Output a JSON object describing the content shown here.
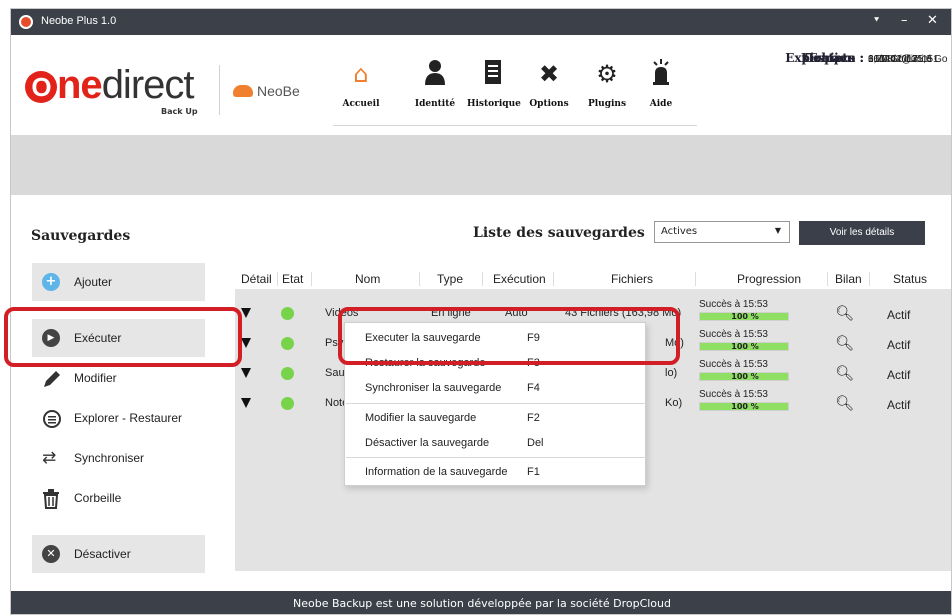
{
  "window": {
    "title": "Neobe Plus 1.0",
    "buttons": [
      "⯆",
      "–",
      "✕"
    ]
  },
  "header": {
    "logo": {
      "o": "O",
      "ne": "ne",
      "direct": "direct",
      "backup": "Back Up"
    },
    "neobe": "NeoBe",
    "tools": [
      {
        "label": "Accueil",
        "icon": "home-icon",
        "active": true
      },
      {
        "label": "Identité",
        "icon": "user-icon"
      },
      {
        "label": "Historique",
        "icon": "document-icon"
      },
      {
        "label": "Options",
        "icon": "tools-icon"
      },
      {
        "label": "Plugins",
        "icon": "gears-icon"
      },
      {
        "label": "Aide",
        "icon": "alarm-light-icon"
      }
    ],
    "account": [
      {
        "key": "Compte :",
        "value": "101444@31151"
      },
      {
        "key": "Expiration :",
        "value": "31/08/2017"
      },
      {
        "key": "Fichiers :",
        "value": "66020 / illimité"
      },
      {
        "key": "Espace :",
        "value": "6,77 Go / 25,0 Go"
      }
    ]
  },
  "sidebar": {
    "title": "Sauvegardes",
    "buttons": [
      {
        "label": "Ajouter",
        "icon": "plus-circle-icon"
      },
      {
        "label": "Exécuter",
        "icon": "play-circle-icon"
      },
      {
        "label": "Modifier",
        "icon": "pencil-icon"
      },
      {
        "label": "Explorer - Restaurer",
        "icon": "explore-icon"
      },
      {
        "label": "Synchroniser",
        "icon": "sync-icon"
      },
      {
        "label": "Corbeille",
        "icon": "trash-icon"
      },
      {
        "label": "Désactiver",
        "icon": "x-circle-icon"
      }
    ]
  },
  "main": {
    "title": "Liste des sauvegardes",
    "filter": "Actives",
    "details_button": "Voir les détails",
    "columns": [
      "Détail",
      "Etat",
      "Nom",
      "Type",
      "Exécution",
      "Fichiers",
      "Progression",
      "Bilan",
      "Status"
    ],
    "rows": [
      {
        "nom": "Vidéos",
        "type": "En ligne",
        "execution": "Auto",
        "fichiers": "43 Fichiers (163,98 Mo)",
        "progress_label": "Succès à 15:53",
        "progress_pct": "100 %",
        "progress": 1.0,
        "status": "Actif"
      },
      {
        "nom": "Psy -",
        "type": "",
        "execution": "",
        "fichiers": "Mo)",
        "progress_label": "Succès à 15:53",
        "progress_pct": "100 %",
        "progress": 1.0,
        "status": "Actif"
      },
      {
        "nom": "Sauve",
        "type": "",
        "execution": "",
        "fichiers": "lo)",
        "progress_label": "Succès à 15:53",
        "progress_pct": "100 %",
        "progress": 1.0,
        "status": "Actif"
      },
      {
        "nom": "Note c",
        "type": "",
        "execution": "",
        "fichiers": "Ko)",
        "progress_label": "Succès à 15:53",
        "progress_pct": "100 %",
        "progress": 1.0,
        "status": "Actif"
      }
    ]
  },
  "context_menu": [
    {
      "label": "Executer la sauvegarde",
      "shortcut": "F9"
    },
    {
      "label": "Restaurer la sauvegarde",
      "shortcut": "F3"
    },
    {
      "label": "Synchroniser la sauvegarde",
      "shortcut": "F4"
    },
    {
      "label": "Modifier la sauvegarde",
      "shortcut": "F2"
    },
    {
      "label": "Désactiver la sauvegarde",
      "shortcut": "Del"
    },
    {
      "label": "Information de la sauvegarde",
      "shortcut": "F1"
    }
  ],
  "footer": "Neobe Backup est une solution développée par la société DropCloud",
  "colors": {
    "accent": "#f08030",
    "brand_red": "#e2231a",
    "highlight": "#d21f26",
    "progress": "#8fdf63",
    "status_dot": "#77d44a"
  }
}
